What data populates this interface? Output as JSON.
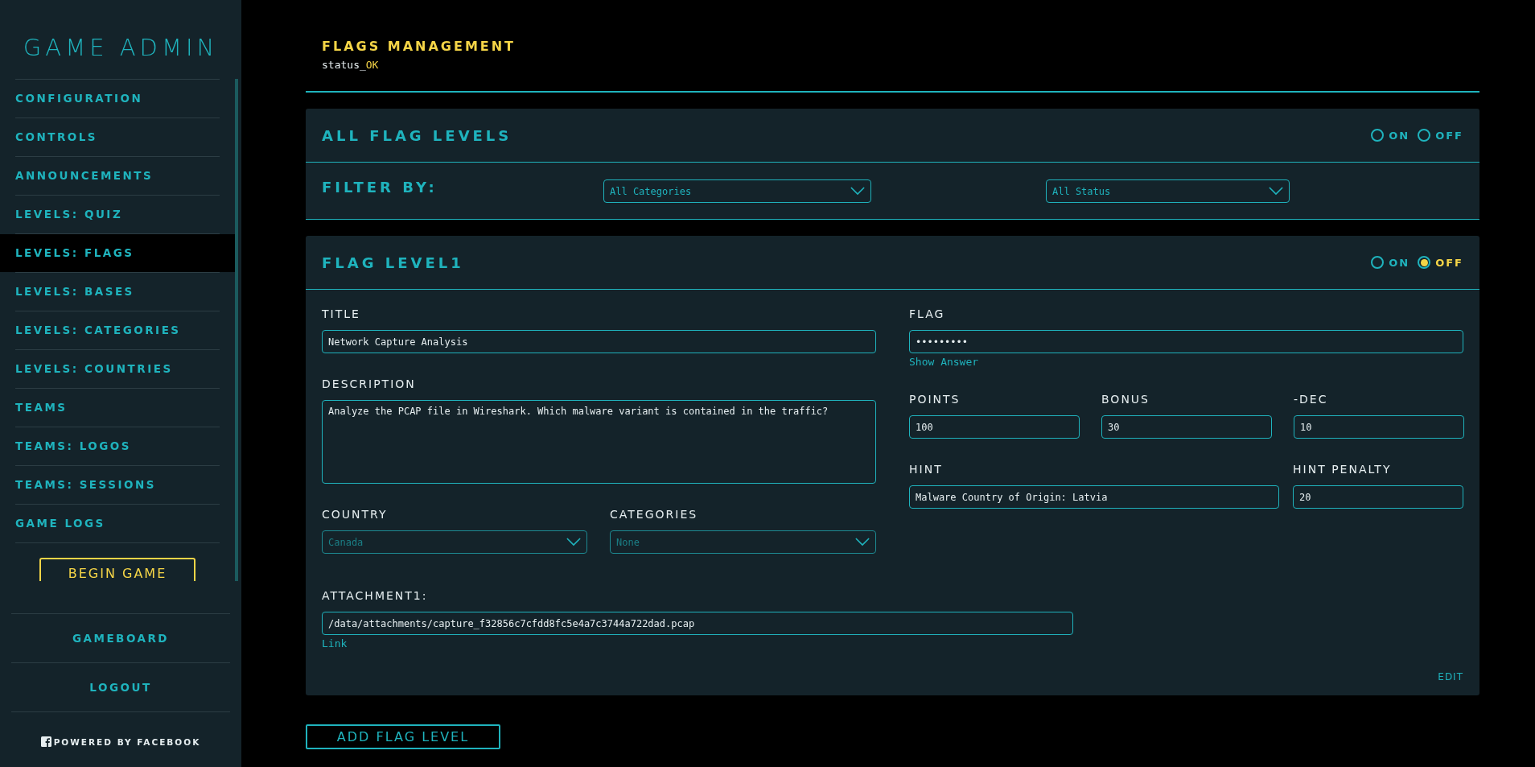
{
  "sidebar": {
    "title": "GAME ADMIN",
    "nav_items": [
      {
        "label": "CONFIGURATION",
        "selected": false
      },
      {
        "label": "CONTROLS",
        "selected": false
      },
      {
        "label": "ANNOUNCEMENTS",
        "selected": false
      },
      {
        "label": "LEVELS: QUIZ",
        "selected": false
      },
      {
        "label": "LEVELS: FLAGS",
        "selected": true
      },
      {
        "label": "LEVELS: BASES",
        "selected": false
      },
      {
        "label": "LEVELS: CATEGORIES",
        "selected": false
      },
      {
        "label": "LEVELS: COUNTRIES",
        "selected": false
      },
      {
        "label": "TEAMS",
        "selected": false
      },
      {
        "label": "TEAMS: LOGOS",
        "selected": false
      },
      {
        "label": "TEAMS: SESSIONS",
        "selected": false
      },
      {
        "label": "GAME LOGS",
        "selected": false
      }
    ],
    "begin_button": "BEGIN GAME",
    "footer_links": [
      "GAMEBOARD",
      "LOGOUT"
    ],
    "powered_by": "POWERED BY FACEBOOK"
  },
  "header": {
    "title": "FLAGS MANAGEMENT",
    "status_label": "status_",
    "status_value": "OK"
  },
  "all_levels": {
    "title": "ALL FLAG LEVELS",
    "toggle": [
      {
        "label": "ON",
        "selected": false
      },
      {
        "label": "OFF",
        "selected": false
      }
    ],
    "filter_label": "FILTER BY:",
    "filters": [
      {
        "value": "All Categories"
      },
      {
        "value": "All Status"
      }
    ]
  },
  "level": {
    "title": "FLAG LEVEL1",
    "toggle": [
      {
        "label": "ON",
        "selected": false
      },
      {
        "label": "OFF",
        "selected": true
      }
    ],
    "title_field": {
      "label": "TITLE",
      "value": "Network Capture Analysis"
    },
    "description_field": {
      "label": "DESCRIPTION",
      "value": "Analyze the PCAP file in Wireshark. Which malware variant is contained in the traffic?"
    },
    "country_field": {
      "label": "COUNTRY",
      "value": "Canada",
      "disabled": true
    },
    "categories_field": {
      "label": "CATEGORIES",
      "value": "None",
      "disabled": true
    },
    "attachment": {
      "label": "ATTACHMENT1:",
      "value": "/data/attachments/capture_f32856c7cfdd8fc5e4a7c3744a722dad.pcap",
      "link": "Link"
    },
    "flag_field": {
      "label": "FLAG",
      "value": "•••••••••",
      "show_answer": "Show Answer"
    },
    "points_row": [
      {
        "label": "POINTS",
        "value": "100"
      },
      {
        "label": "BONUS",
        "value": "30"
      },
      {
        "label": "-DEC",
        "value": "10"
      }
    ],
    "hint_field": {
      "label": "HINT",
      "value": "Malware Country of Origin: Latvia"
    },
    "hint_penalty_field": {
      "label": "HINT PENALTY",
      "value": "20"
    },
    "edit_link": "EDIT"
  },
  "add_button": "ADD FLAG LEVEL"
}
